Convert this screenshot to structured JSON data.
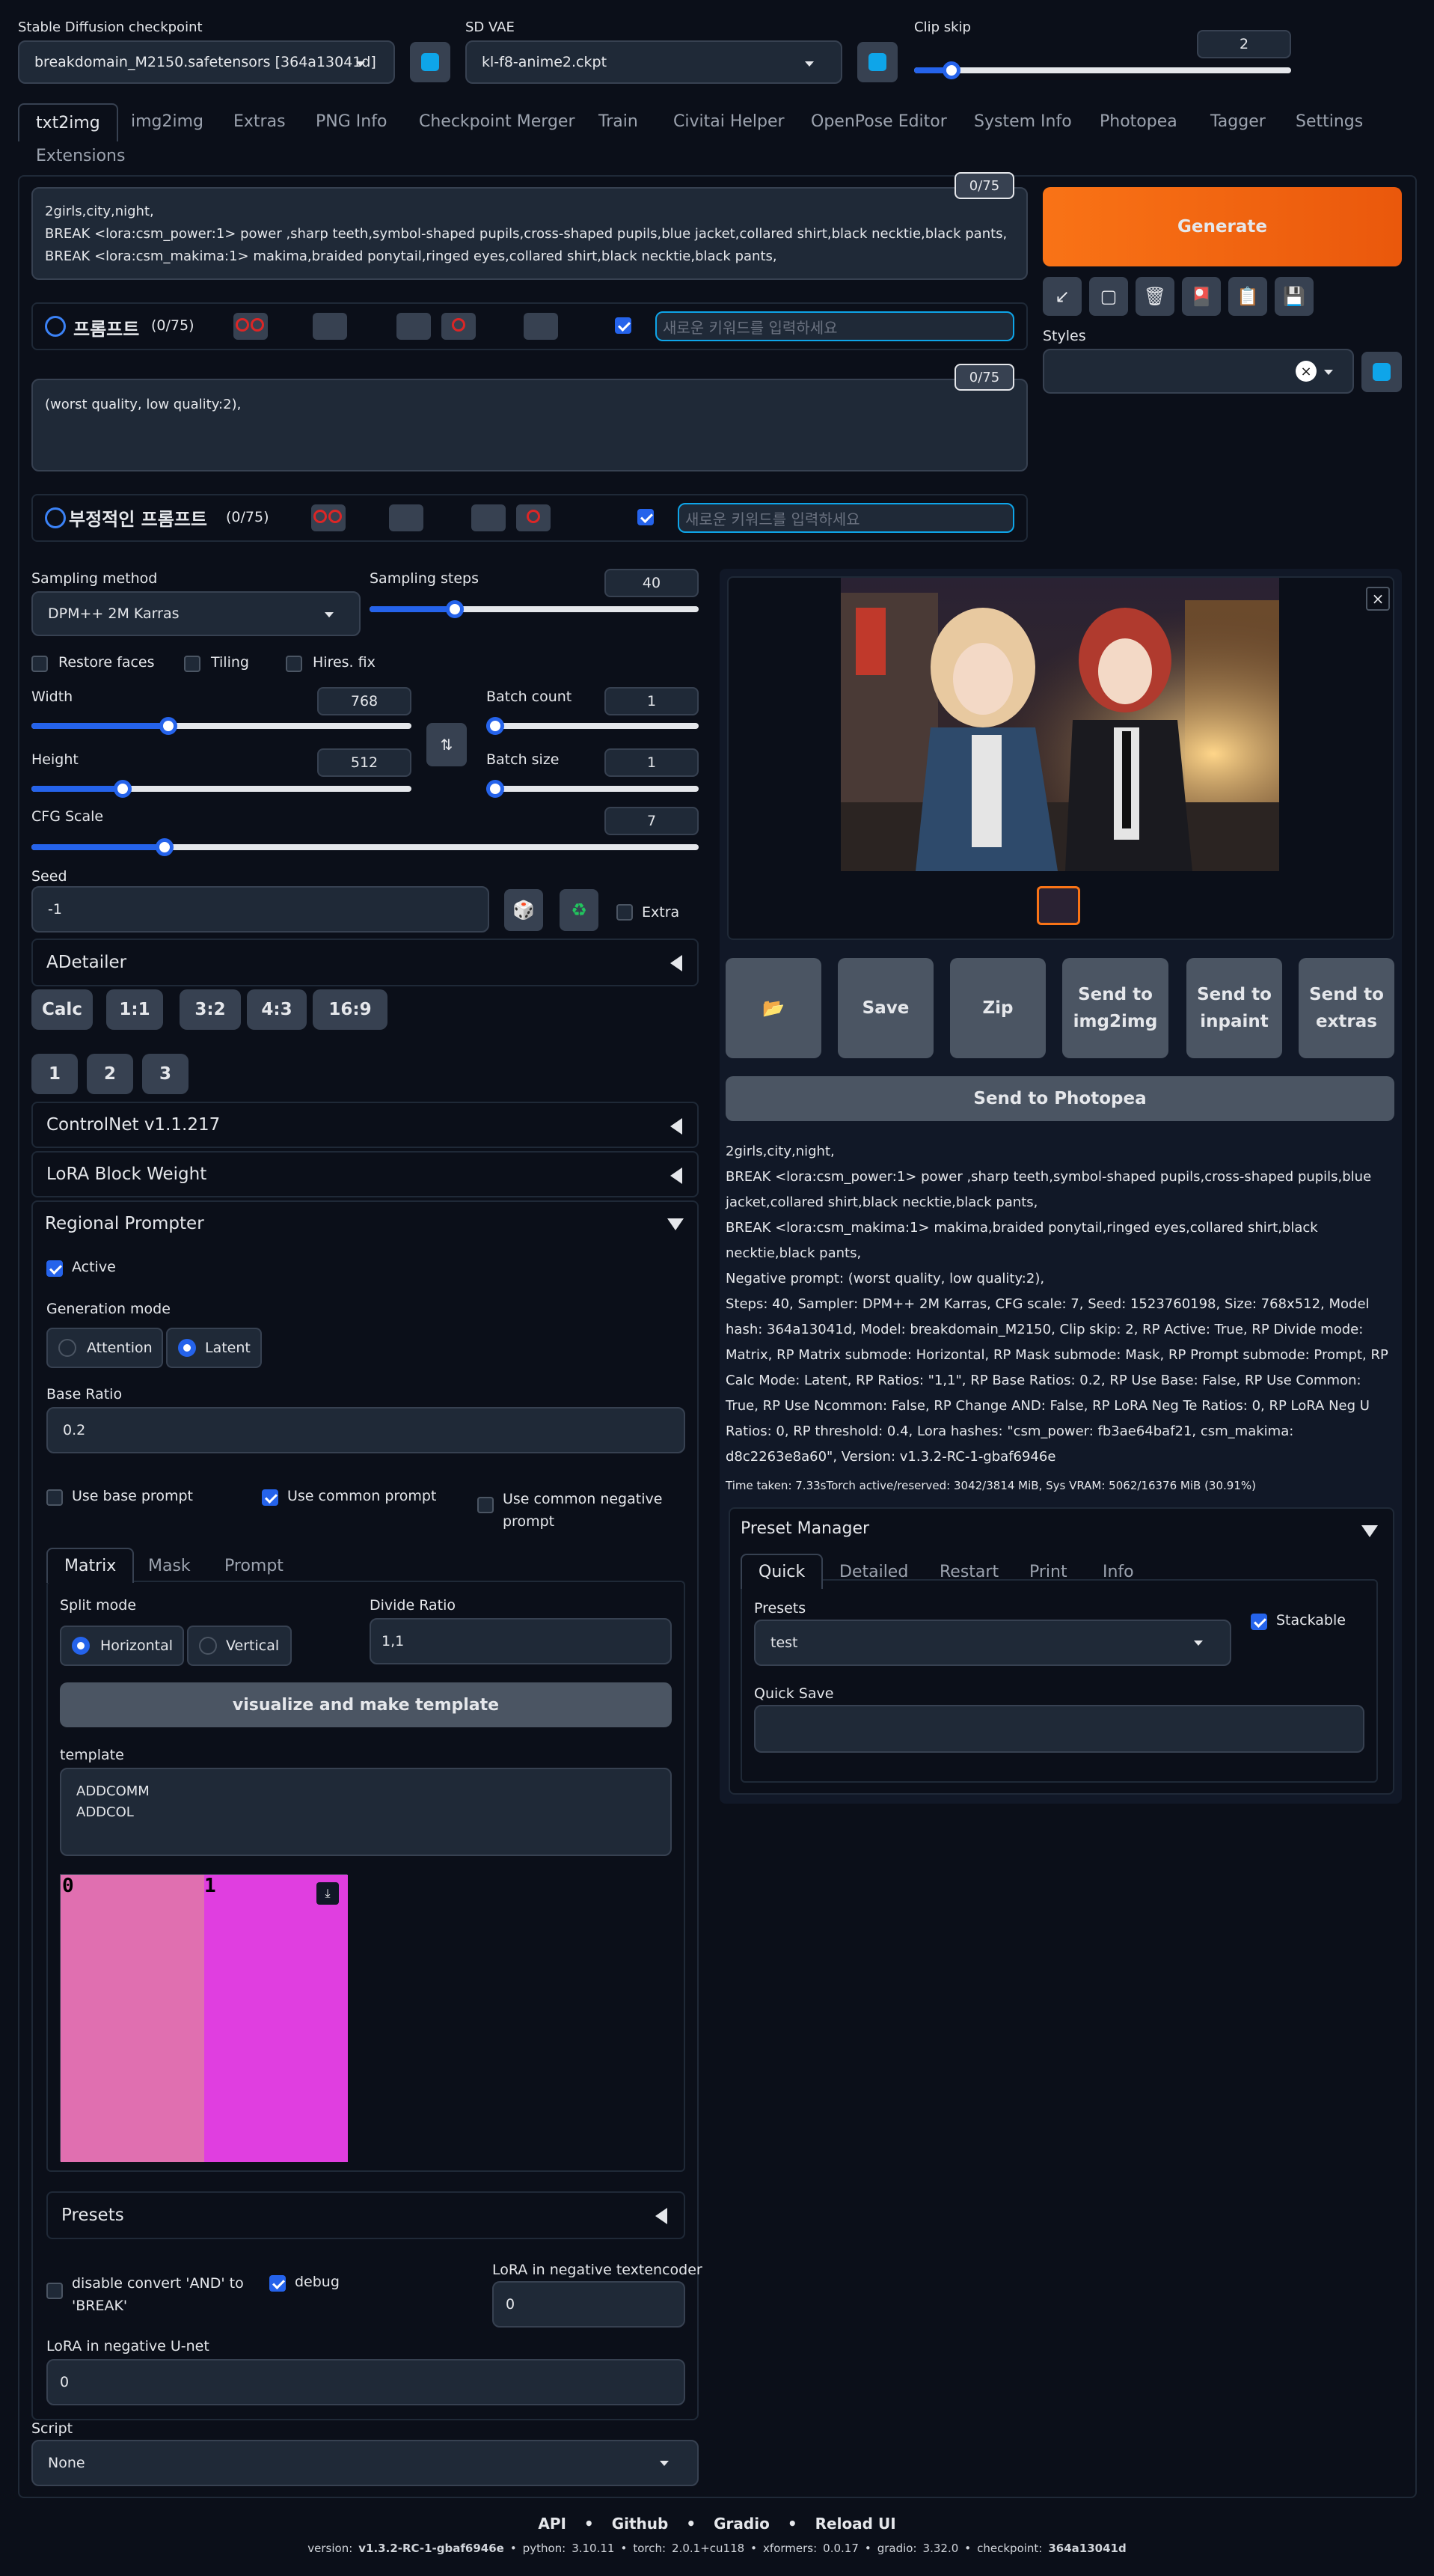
{
  "top": {
    "ckpt_label": "Stable Diffusion checkpoint",
    "ckpt_value": "breakdomain_M2150.safetensors [364a13041d]",
    "vae_label": "SD VAE",
    "vae_value": "kl-f8-anime2.ckpt",
    "clip_label": "Clip skip",
    "clip_value": "2"
  },
  "tabs": [
    "txt2img",
    "img2img",
    "Extras",
    "PNG Info",
    "Checkpoint Merger",
    "Train",
    "Civitai Helper",
    "OpenPose Editor",
    "System Info",
    "Photopea",
    "Tagger",
    "Settings",
    "Extensions"
  ],
  "prompt": {
    "text_lines": [
      "2girls,city,night,",
      "BREAK   <lora:csm_power:1> power ,sharp teeth,symbol-shaped pupils,cross-shaped pupils,blue jacket,collared shirt,black necktie,black pants,",
      "BREAK   <lora:csm_makima:1> makima,braided ponytail,ringed eyes,collared shirt,black necktie,black pants,"
    ],
    "counter": "0/75",
    "section_title": "프롬프트",
    "section_count": "(0/75)",
    "keyword_placeholder": "새로운 키워드를 입력하세요"
  },
  "negative": {
    "text": "(worst quality, low quality:2),",
    "counter": "0/75",
    "section_title": "부정적인 프롬프트",
    "section_count": "(0/75)",
    "keyword_placeholder": "새로운 키워드를 입력하세요"
  },
  "generate": {
    "label": "Generate",
    "styles_label": "Styles"
  },
  "sampling": {
    "method_label": "Sampling method",
    "method_value": "DPM++ 2M Karras",
    "steps_label": "Sampling steps",
    "steps_value": "40",
    "steps_fraction": 0.26,
    "restore_faces": "Restore faces",
    "tiling": "Tiling",
    "hires": "Hires. fix"
  },
  "size": {
    "width_label": "Width",
    "width_value": "768",
    "width_fraction": 0.36,
    "height_label": "Height",
    "height_value": "512",
    "height_fraction": 0.24,
    "batch_count_label": "Batch count",
    "batch_count_value": "1",
    "batch_size_label": "Batch size",
    "batch_size_value": "1",
    "cfg_label": "CFG Scale",
    "cfg_value": "7",
    "cfg_fraction": 0.2
  },
  "seed": {
    "label": "Seed",
    "value": "-1",
    "extra": "Extra"
  },
  "adetailer": {
    "title": "ADetailer"
  },
  "ratio_buttons": [
    "Calc",
    "1:1",
    "3:2",
    "4:3",
    "16:9"
  ],
  "num_buttons": [
    "1",
    "2",
    "3"
  ],
  "accordions": {
    "controlnet": "ControlNet v1.1.217",
    "lora_block": "LoRA Block Weight",
    "regional": "Regional Prompter"
  },
  "regional": {
    "active": "Active",
    "gen_mode_label": "Generation mode",
    "attention": "Attention",
    "latent": "Latent",
    "base_ratio_label": "Base Ratio",
    "base_ratio_value": "0.2",
    "use_base": "Use base prompt",
    "use_common": "Use common prompt",
    "use_common_neg": "Use common negative prompt",
    "subtabs": [
      "Matrix",
      "Mask",
      "Prompt"
    ],
    "split_label": "Split mode",
    "horizontal": "Horizontal",
    "vertical": "Vertical",
    "divide_label": "Divide Ratio",
    "divide_value": "1,1",
    "visualize": "visualize and make template",
    "template_label": "template",
    "template_lines": [
      "ADDCOMM",
      "ADDCOL"
    ],
    "region_labels": [
      "0",
      "1"
    ],
    "region_colors": [
      "#e06fb0",
      "#e03ee0"
    ],
    "presets": "Presets",
    "disable_convert": "disable convert 'AND' to 'BREAK'",
    "debug": "debug",
    "lora_neg_text_label": "LoRA in negative textencoder",
    "lora_neg_text_value": "0",
    "lora_neg_unet_label": "LoRA in negative U-net",
    "lora_neg_unet_value": "0"
  },
  "script": {
    "label": "Script",
    "value": "None"
  },
  "output": {
    "buttons": [
      "📂",
      "Save",
      "Zip",
      "Send to img2img",
      "Send to inpaint",
      "Send to extras"
    ],
    "photopea": "Send to Photopea",
    "info_lines": [
      "2girls,city,night,",
      "BREAK <lora:csm_power:1> power ,sharp teeth,symbol-shaped pupils,cross-shaped pupils,blue jacket,collared shirt,black necktie,black pants,",
      "BREAK <lora:csm_makima:1> makima,braided ponytail,ringed eyes,collared shirt,black necktie,black pants,",
      "Negative prompt: (worst quality, low quality:2),",
      "Steps: 40, Sampler: DPM++ 2M Karras, CFG scale: 7, Seed: 1523760198, Size: 768x512, Model hash: 364a13041d, Model: breakdomain_M2150, Clip skip: 2, RP Active: True, RP Divide mode: Matrix, RP Matrix submode: Horizontal, RP Mask submode: Mask, RP Prompt submode: Prompt, RP Calc Mode: Latent, RP Ratios: \"1,1\", RP Base Ratios: 0.2, RP Use Base: False, RP Use Common: True, RP Use Ncommon: False, RP Change AND: False, RP LoRA Neg Te Ratios: 0, RP LoRA Neg U Ratios: 0, RP threshold: 0.4, Lora hashes: \"csm_power: fb3ae64baf21, csm_makima: d8c2263e8a60\", Version: v1.3.2-RC-1-gbaf6946e"
    ],
    "time_taken": "Time taken: 7.33sTorch active/reserved: 3042/3814 MiB, Sys VRAM: 5062/16376 MiB (30.91%)"
  },
  "preset_manager": {
    "title": "Preset Manager",
    "tabs": [
      "Quick",
      "Detailed",
      "Restart",
      "Print",
      "Info"
    ],
    "presets_label": "Presets",
    "presets_value": "test",
    "stackable": "Stackable",
    "quick_save_label": "Quick Save"
  },
  "footer": {
    "links": [
      "API",
      "Github",
      "Gradio",
      "Reload UI"
    ],
    "sep": "•",
    "version_label": "version:",
    "version": "v1.3.2-RC-1-gbaf6946e",
    "python_label": "python:",
    "python": "3.10.11",
    "torch_label": "torch:",
    "torch": "2.0.1+cu118",
    "xformers_label": "xformers:",
    "xformers": "0.0.17",
    "gradio_label": "gradio:",
    "gradio": "3.32.0",
    "checkpoint_label": "checkpoint:",
    "checkpoint": "364a13041d"
  },
  "icons": [
    "refresh-icon",
    "arrow-icon",
    "clear-icon",
    "trash-icon",
    "palette-icon",
    "clipboard-icon",
    "save-icon",
    "dice-icon",
    "recycle-icon",
    "swap-icon",
    "folder-icon",
    "close-icon",
    "download-icon"
  ]
}
